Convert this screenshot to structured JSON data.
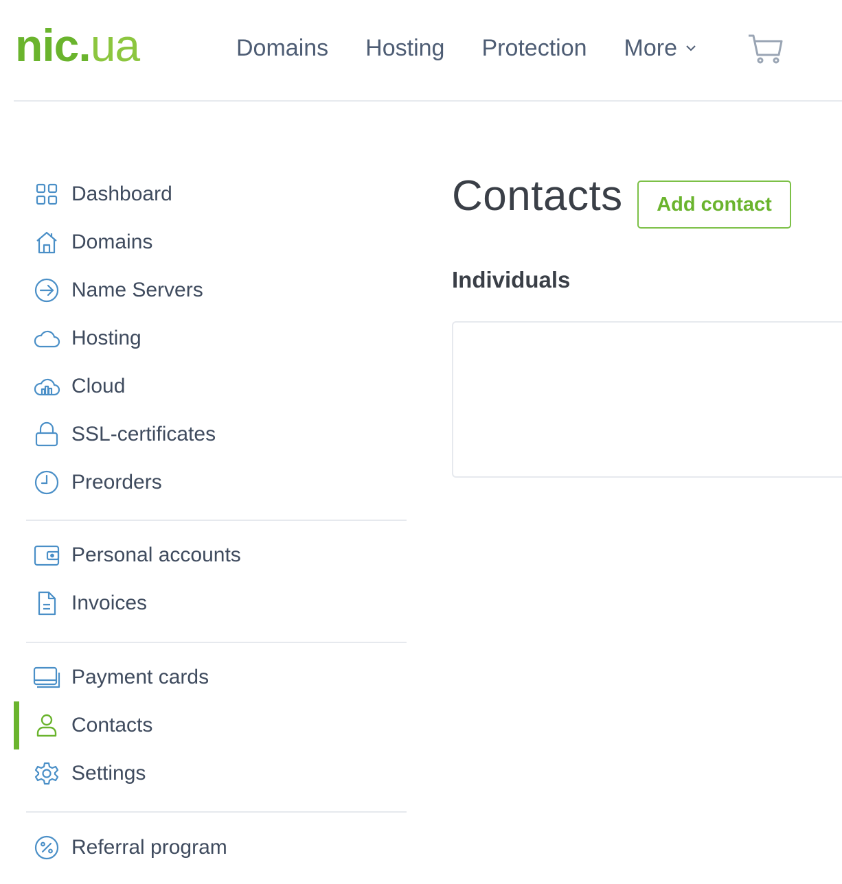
{
  "header": {
    "logo": {
      "part1": "nic",
      "dot": ".",
      "part2": "ua"
    },
    "nav": [
      {
        "label": "Domains"
      },
      {
        "label": "Hosting"
      },
      {
        "label": "Protection"
      },
      {
        "label": "More",
        "icon": "chevron-down-icon"
      }
    ],
    "cart_icon": "cart-icon"
  },
  "sidebar": {
    "groups": [
      [
        {
          "label": "Dashboard",
          "icon": "dashboard-grid-icon"
        },
        {
          "label": "Domains",
          "icon": "house-icon"
        },
        {
          "label": "Name Servers",
          "icon": "arrow-circle-icon"
        },
        {
          "label": "Hosting",
          "icon": "cloud-icon"
        },
        {
          "label": "Cloud",
          "icon": "cloud-chart-icon"
        },
        {
          "label": "SSL-certificates",
          "icon": "lock-icon"
        },
        {
          "label": "Preorders",
          "icon": "clock-icon"
        }
      ],
      [
        {
          "label": "Personal accounts",
          "icon": "wallet-icon"
        },
        {
          "label": "Invoices",
          "icon": "document-icon"
        }
      ],
      [
        {
          "label": "Payment cards",
          "icon": "cards-icon"
        },
        {
          "label": "Contacts",
          "icon": "person-icon",
          "active": true
        },
        {
          "label": "Settings",
          "icon": "gear-icon"
        }
      ],
      [
        {
          "label": "Referral program",
          "icon": "percent-icon"
        }
      ]
    ]
  },
  "main": {
    "title": "Contacts",
    "add_button": "Add contact",
    "section_title": "Individuals"
  },
  "colors": {
    "brand_green": "#6ab42d",
    "light_green": "#8cc63f",
    "icon_blue": "#4a8fc7",
    "text": "#3f4b5e",
    "nav_text": "#4e5d74",
    "divider": "#e6e9ee"
  }
}
